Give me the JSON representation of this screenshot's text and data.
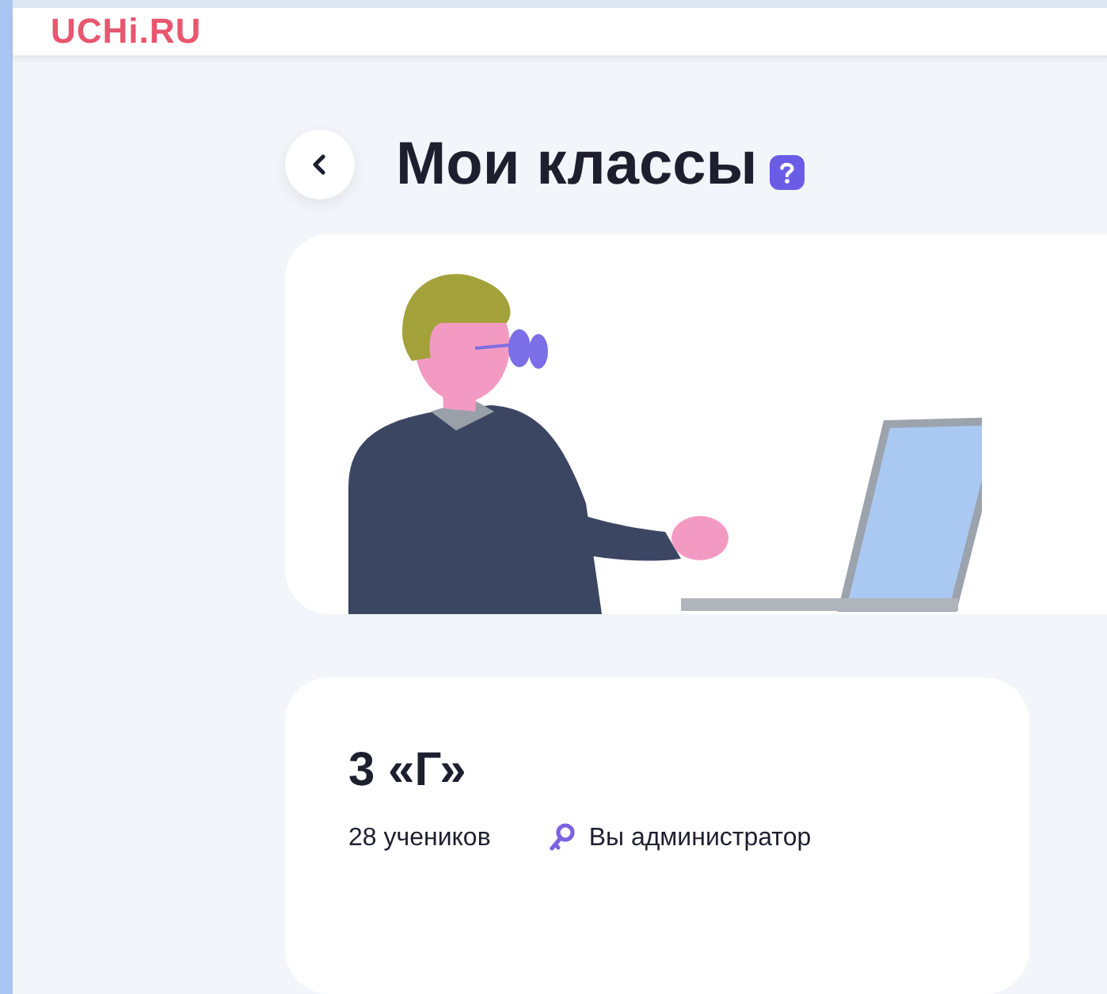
{
  "header": {
    "logo": "UCHi.RU"
  },
  "page": {
    "title": "Мои классы"
  },
  "classes": [
    {
      "name": "3 «Г»",
      "students": "28 учеников",
      "role": "Вы администратор"
    }
  ]
}
